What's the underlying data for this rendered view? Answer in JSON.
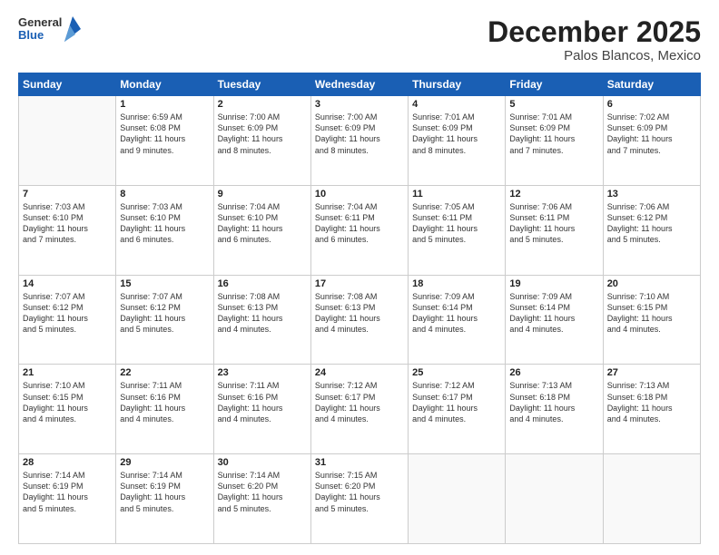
{
  "header": {
    "logo_general": "General",
    "logo_blue": "Blue",
    "title": "December 2025",
    "subtitle": "Palos Blancos, Mexico"
  },
  "days_of_week": [
    "Sunday",
    "Monday",
    "Tuesday",
    "Wednesday",
    "Thursday",
    "Friday",
    "Saturday"
  ],
  "weeks": [
    [
      {
        "day": "",
        "content": ""
      },
      {
        "day": "1",
        "content": "Sunrise: 6:59 AM\nSunset: 6:08 PM\nDaylight: 11 hours\nand 9 minutes."
      },
      {
        "day": "2",
        "content": "Sunrise: 7:00 AM\nSunset: 6:09 PM\nDaylight: 11 hours\nand 8 minutes."
      },
      {
        "day": "3",
        "content": "Sunrise: 7:00 AM\nSunset: 6:09 PM\nDaylight: 11 hours\nand 8 minutes."
      },
      {
        "day": "4",
        "content": "Sunrise: 7:01 AM\nSunset: 6:09 PM\nDaylight: 11 hours\nand 8 minutes."
      },
      {
        "day": "5",
        "content": "Sunrise: 7:01 AM\nSunset: 6:09 PM\nDaylight: 11 hours\nand 7 minutes."
      },
      {
        "day": "6",
        "content": "Sunrise: 7:02 AM\nSunset: 6:09 PM\nDaylight: 11 hours\nand 7 minutes."
      }
    ],
    [
      {
        "day": "7",
        "content": "Sunrise: 7:03 AM\nSunset: 6:10 PM\nDaylight: 11 hours\nand 7 minutes."
      },
      {
        "day": "8",
        "content": "Sunrise: 7:03 AM\nSunset: 6:10 PM\nDaylight: 11 hours\nand 6 minutes."
      },
      {
        "day": "9",
        "content": "Sunrise: 7:04 AM\nSunset: 6:10 PM\nDaylight: 11 hours\nand 6 minutes."
      },
      {
        "day": "10",
        "content": "Sunrise: 7:04 AM\nSunset: 6:11 PM\nDaylight: 11 hours\nand 6 minutes."
      },
      {
        "day": "11",
        "content": "Sunrise: 7:05 AM\nSunset: 6:11 PM\nDaylight: 11 hours\nand 5 minutes."
      },
      {
        "day": "12",
        "content": "Sunrise: 7:06 AM\nSunset: 6:11 PM\nDaylight: 11 hours\nand 5 minutes."
      },
      {
        "day": "13",
        "content": "Sunrise: 7:06 AM\nSunset: 6:12 PM\nDaylight: 11 hours\nand 5 minutes."
      }
    ],
    [
      {
        "day": "14",
        "content": "Sunrise: 7:07 AM\nSunset: 6:12 PM\nDaylight: 11 hours\nand 5 minutes."
      },
      {
        "day": "15",
        "content": "Sunrise: 7:07 AM\nSunset: 6:12 PM\nDaylight: 11 hours\nand 5 minutes."
      },
      {
        "day": "16",
        "content": "Sunrise: 7:08 AM\nSunset: 6:13 PM\nDaylight: 11 hours\nand 4 minutes."
      },
      {
        "day": "17",
        "content": "Sunrise: 7:08 AM\nSunset: 6:13 PM\nDaylight: 11 hours\nand 4 minutes."
      },
      {
        "day": "18",
        "content": "Sunrise: 7:09 AM\nSunset: 6:14 PM\nDaylight: 11 hours\nand 4 minutes."
      },
      {
        "day": "19",
        "content": "Sunrise: 7:09 AM\nSunset: 6:14 PM\nDaylight: 11 hours\nand 4 minutes."
      },
      {
        "day": "20",
        "content": "Sunrise: 7:10 AM\nSunset: 6:15 PM\nDaylight: 11 hours\nand 4 minutes."
      }
    ],
    [
      {
        "day": "21",
        "content": "Sunrise: 7:10 AM\nSunset: 6:15 PM\nDaylight: 11 hours\nand 4 minutes."
      },
      {
        "day": "22",
        "content": "Sunrise: 7:11 AM\nSunset: 6:16 PM\nDaylight: 11 hours\nand 4 minutes."
      },
      {
        "day": "23",
        "content": "Sunrise: 7:11 AM\nSunset: 6:16 PM\nDaylight: 11 hours\nand 4 minutes."
      },
      {
        "day": "24",
        "content": "Sunrise: 7:12 AM\nSunset: 6:17 PM\nDaylight: 11 hours\nand 4 minutes."
      },
      {
        "day": "25",
        "content": "Sunrise: 7:12 AM\nSunset: 6:17 PM\nDaylight: 11 hours\nand 4 minutes."
      },
      {
        "day": "26",
        "content": "Sunrise: 7:13 AM\nSunset: 6:18 PM\nDaylight: 11 hours\nand 4 minutes."
      },
      {
        "day": "27",
        "content": "Sunrise: 7:13 AM\nSunset: 6:18 PM\nDaylight: 11 hours\nand 4 minutes."
      }
    ],
    [
      {
        "day": "28",
        "content": "Sunrise: 7:14 AM\nSunset: 6:19 PM\nDaylight: 11 hours\nand 5 minutes."
      },
      {
        "day": "29",
        "content": "Sunrise: 7:14 AM\nSunset: 6:19 PM\nDaylight: 11 hours\nand 5 minutes."
      },
      {
        "day": "30",
        "content": "Sunrise: 7:14 AM\nSunset: 6:20 PM\nDaylight: 11 hours\nand 5 minutes."
      },
      {
        "day": "31",
        "content": "Sunrise: 7:15 AM\nSunset: 6:20 PM\nDaylight: 11 hours\nand 5 minutes."
      },
      {
        "day": "",
        "content": ""
      },
      {
        "day": "",
        "content": ""
      },
      {
        "day": "",
        "content": ""
      }
    ]
  ]
}
